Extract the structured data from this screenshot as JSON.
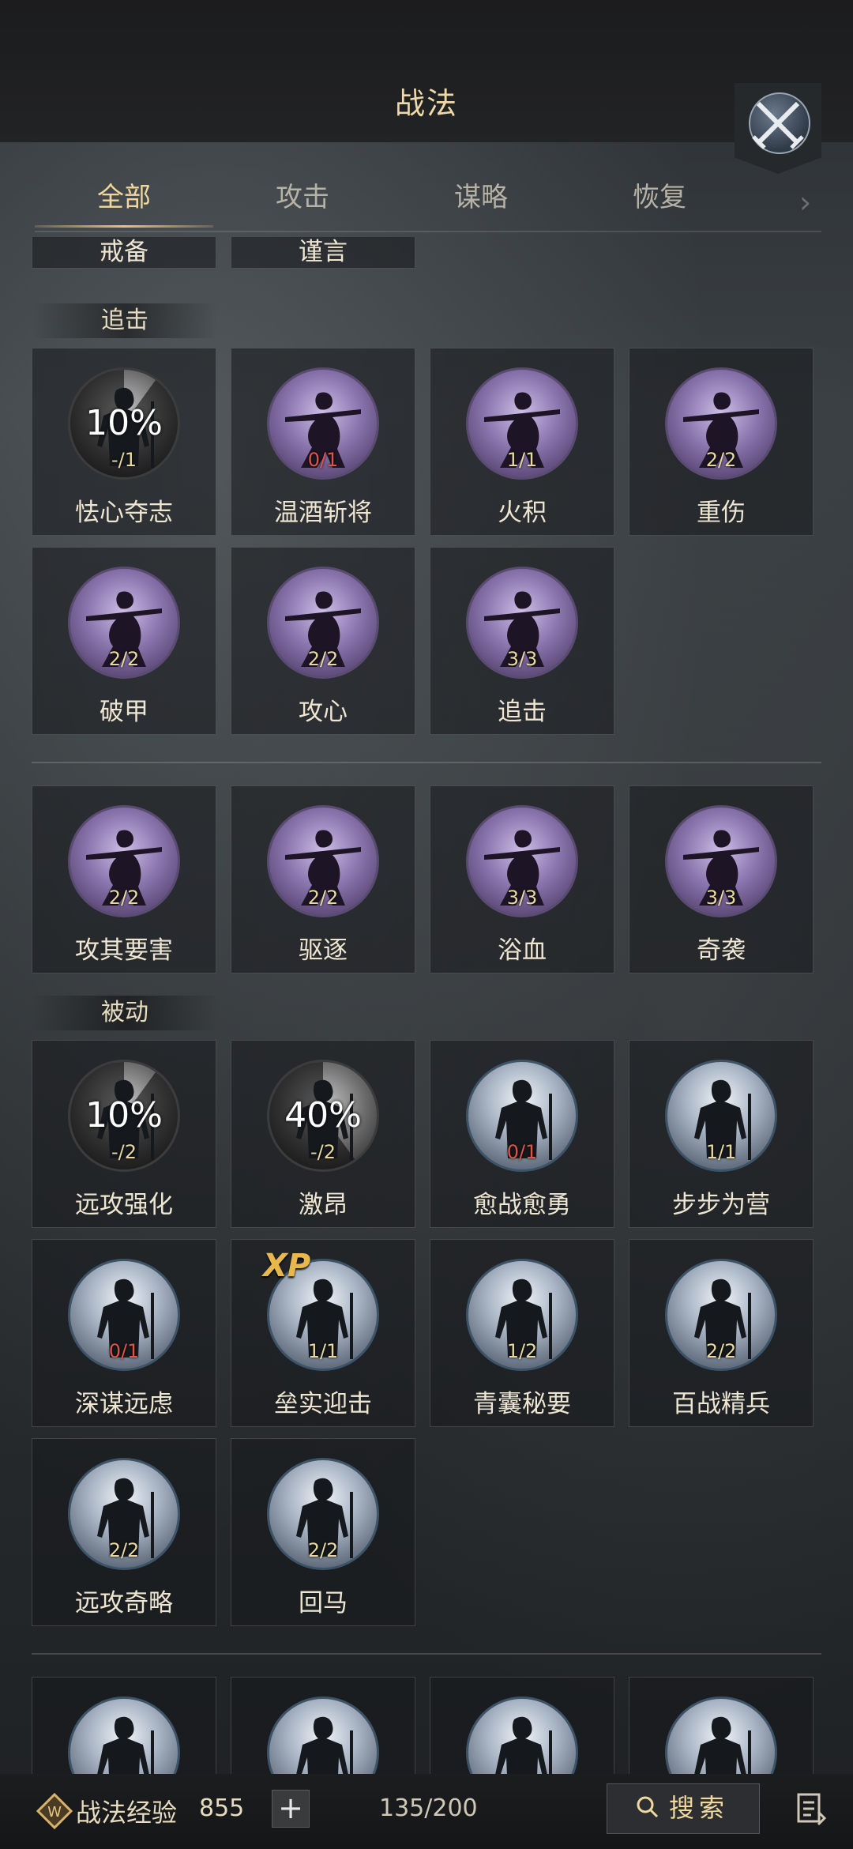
{
  "header": {
    "title": "战法",
    "close_icon": "crossed-swords-icon"
  },
  "tabs": [
    {
      "label": "全部",
      "active": true
    },
    {
      "label": "攻击",
      "active": false
    },
    {
      "label": "谋略",
      "active": false
    },
    {
      "label": "恢复",
      "active": false
    }
  ],
  "top_partial": [
    {
      "name": "戒备"
    },
    {
      "name": "谨言"
    }
  ],
  "sections": {
    "chase": {
      "label": "追击",
      "cards": [
        {
          "name": "怯心夺志",
          "type": "gray",
          "count": "-/1",
          "percent": "10%",
          "progress": 0.1
        },
        {
          "name": "温酒斩将",
          "type": "purple",
          "count": "0/1",
          "count_red": true
        },
        {
          "name": "火积",
          "type": "purple",
          "count": "1/1"
        },
        {
          "name": "重伤",
          "type": "purple",
          "count": "2/2"
        },
        {
          "name": "破甲",
          "type": "purple",
          "count": "2/2"
        },
        {
          "name": "攻心",
          "type": "purple",
          "count": "2/2"
        },
        {
          "name": "追击",
          "type": "purple",
          "count": "3/3"
        }
      ]
    },
    "chase_more": {
      "cards": [
        {
          "name": "攻其要害",
          "type": "purple",
          "count": "2/2"
        },
        {
          "name": "驱逐",
          "type": "purple",
          "count": "2/2"
        },
        {
          "name": "浴血",
          "type": "purple",
          "count": "3/3"
        },
        {
          "name": "奇袭",
          "type": "purple",
          "count": "3/3"
        }
      ]
    },
    "passive": {
      "label": "被动",
      "cards": [
        {
          "name": "远攻强化",
          "type": "gray",
          "count": "-/2",
          "percent": "10%",
          "progress": 0.1
        },
        {
          "name": "激昂",
          "type": "gray",
          "count": "-/2",
          "percent": "40%",
          "progress": 0.4
        },
        {
          "name": "愈战愈勇",
          "type": "blue",
          "count": "0/1",
          "count_red": true
        },
        {
          "name": "步步为营",
          "type": "blue",
          "count": "1/1"
        },
        {
          "name": "深谋远虑",
          "type": "blue",
          "count": "0/1",
          "count_red": true
        },
        {
          "name": "垒实迎击",
          "type": "blue",
          "count": "1/1",
          "xp": "XP"
        },
        {
          "name": "青囊秘要",
          "type": "blue",
          "count": "1/2"
        },
        {
          "name": "百战精兵",
          "type": "blue",
          "count": "2/2"
        },
        {
          "name": "远攻奇略",
          "type": "blue",
          "count": "2/2"
        },
        {
          "name": "回马",
          "type": "blue",
          "count": "2/2"
        }
      ]
    }
  },
  "footer": {
    "exp_label": "战法经验",
    "exp_value": "855",
    "add_label": "+",
    "capacity": "135/200",
    "search_label": "搜索"
  }
}
